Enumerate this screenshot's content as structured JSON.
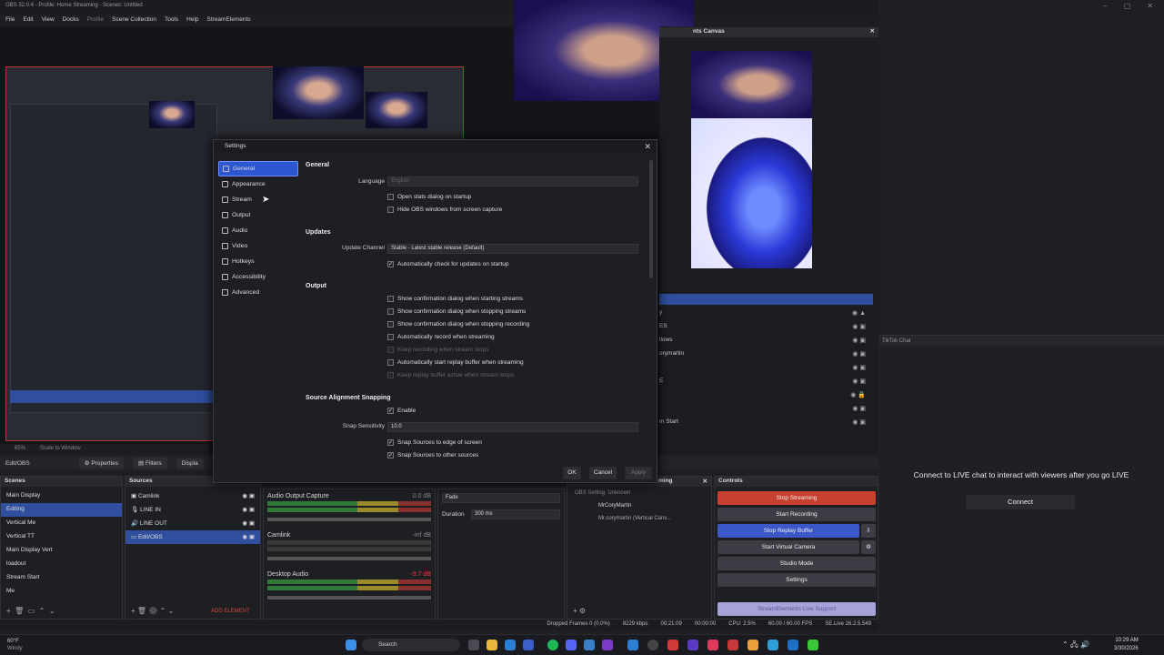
{
  "window": {
    "title": "OBS 32.0.4 - Profile: Home Streaming - Scenes: Untitled"
  },
  "menu": [
    "File",
    "Edit",
    "View",
    "Docks",
    "Profile",
    "Scene Collection",
    "Tools",
    "Help",
    "StreamElements"
  ],
  "canvas_panel": {
    "title": "nts Canvas"
  },
  "preview_bar": {
    "zoom": "65%",
    "scale": "Scale to Window"
  },
  "dockbar": {
    "source_name": "Edit/OBS",
    "properties": "Properties",
    "filters": "Filters",
    "display": "Displa"
  },
  "scenes": {
    "header": "Scenes",
    "items": [
      "Main Display",
      "Editing",
      "Vertical Me",
      "Vertical TT",
      "Main Display Vert",
      "loadout",
      "Stream Start",
      "Me"
    ],
    "selected": 1
  },
  "sources": {
    "header": "Sources",
    "items": [
      "Camlink",
      "LINE IN",
      "LINE OUT",
      "Edit/OBS"
    ],
    "selected": 3,
    "add_element": "ADD ELEMENT"
  },
  "mixer": {
    "channels": [
      {
        "name": "Audio Output Capture",
        "db": "0.0 dB"
      },
      {
        "name": "Camlink",
        "db": "-inf dB"
      },
      {
        "name": "Desktop Audio",
        "db": "-9.7 dB"
      }
    ]
  },
  "transitions": {
    "type": "Fade",
    "duration_label": "Duration",
    "duration_value": "300 ms"
  },
  "streaming_dock": {
    "header": "ming",
    "items": [
      "OBS Setting: Unknown",
      "MrCoryMartin",
      "Mr.corymartin (Vertical Canv..."
    ]
  },
  "controls": {
    "header": "Controls",
    "buttons": [
      "Stop Streaming",
      "Start Recording",
      "Stop Replay Buffer",
      "Start Virtual Camera",
      "Studio Mode",
      "Settings"
    ],
    "live_support": "StreamElements Live Support"
  },
  "right_list": [
    "y",
    "ES",
    "llows",
    "orymartin",
    "",
    "E",
    "",
    "",
    "m Start"
  ],
  "status": {
    "dropped": "Dropped Frames 0 (0.0%)",
    "bitrate": "8229 kbps",
    "rec_time": "00:21:09",
    "time2": "00:00:00",
    "cpu": "CPU: 2.5%",
    "fps": "60.00 / 60.00 FPS",
    "se": "SE.Live 26.2.5.549"
  },
  "tiktok": {
    "header": "TikTok Chat",
    "message": "Connect to LIVE chat to interact with viewers after you go LIVE",
    "button": "Connect"
  },
  "settings": {
    "title": "Settings",
    "nav": [
      {
        "label": "General",
        "icon": "gear-icon"
      },
      {
        "label": "Appearance",
        "icon": "brush-icon"
      },
      {
        "label": "Stream",
        "icon": "antenna-icon"
      },
      {
        "label": "Output",
        "icon": "output-icon"
      },
      {
        "label": "Audio",
        "icon": "speaker-icon"
      },
      {
        "label": "Video",
        "icon": "monitor-icon"
      },
      {
        "label": "Hotkeys",
        "icon": "keyboard-icon"
      },
      {
        "label": "Accessibility",
        "icon": "accessibility-icon"
      },
      {
        "label": "Advanced",
        "icon": "wrench-icon"
      }
    ],
    "selected_nav": 0,
    "general": {
      "section": "General",
      "language_label": "Language",
      "language_value": "English",
      "open_stats": "Open stats dialog on startup",
      "hide_obs": "Hide OBS windows from screen capture"
    },
    "updates": {
      "section": "Updates",
      "channel_label": "Update Channel",
      "channel_value": "Stable - Latest stable release (Default)",
      "auto_check": "Automatically check for updates on startup"
    },
    "output": {
      "section": "Output",
      "opts": [
        "Show confirmation dialog when starting streams",
        "Show confirmation dialog when stopping streams",
        "Show confirmation dialog when stopping recording",
        "Automatically record when streaming",
        "Keep recording when stream stops",
        "Automatically start replay buffer when streaming",
        "Keep replay buffer active when stream stops"
      ]
    },
    "snapping": {
      "section": "Source Alignment Snapping",
      "enable": "Enable",
      "sens_label": "Snap Sensitivity",
      "sens_value": "10.0",
      "edge": "Snap Sources to edge of screen",
      "other": "Snap Sources to other sources"
    },
    "buttons": {
      "ok": "OK",
      "cancel": "Cancel",
      "apply": "Apply"
    }
  },
  "taskbar": {
    "weather_temp": "60°F",
    "weather_desc": "Windy",
    "search": "Search",
    "time": "10:29 AM",
    "date": "3/30/2026"
  }
}
